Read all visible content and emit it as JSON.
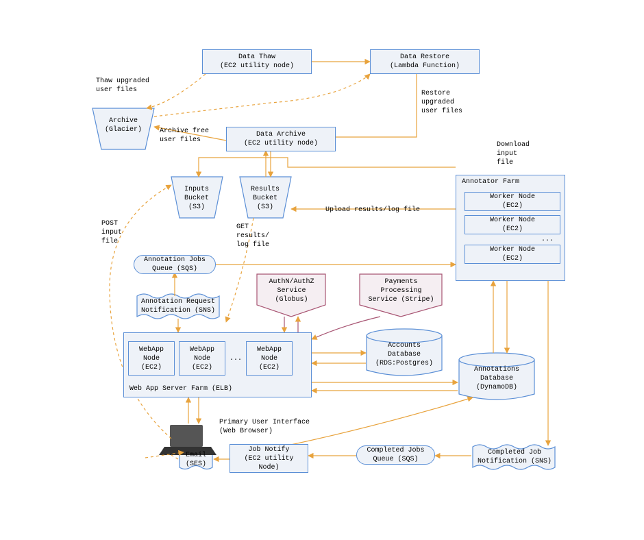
{
  "boxes": {
    "data_thaw": "Data Thaw\n(EC2 utility node)",
    "data_restore": "Data Restore\n(Lambda Function)",
    "archive": "Archive\n(Glacier)",
    "data_archive": "Data Archive\n(EC2 utility node)",
    "inputs_bucket": "Inputs\nBucket\n(S3)",
    "results_bucket": "Results\nBucket\n(S3)",
    "annotator_farm_title": "Annotator Farm",
    "worker_node": "Worker Node\n(EC2)",
    "worker_ellipsis": "...",
    "ann_jobs_queue": "Annotation Jobs\nQueue (SQS)",
    "ann_req_notif": "Annotation Request\nNotification (SNS)",
    "authn": "AuthN/AuthZ\nService\n(Globus)",
    "payments": "Payments\nProcessing\nService (Stripe)",
    "webapp_node": "WebApp\nNode\n(EC2)",
    "webapp_ellipsis": "...",
    "webapp_farm_title": "Web App Server Farm (ELB)",
    "accounts_db": "Accounts\nDatabase\n(RDS:Postgres)",
    "annotations_db": "Annotations\nDatabase\n(DynamoDB)",
    "primary_ui": "Primary User Interface\n(Web Browser)",
    "email_ses": "Email\n(SES)",
    "job_notify": "Job Notify\n(EC2 utility\nNode)",
    "completed_queue": "Completed Jobs\nQueue (SQS)",
    "completed_notif": "Completed Job\nNotification (SNS)"
  },
  "labels": {
    "thaw_upgraded": "Thaw upgraded\nuser files",
    "archive_free": "Archive free\nuser files",
    "restore_upgraded": "Restore\nupgraded\nuser files",
    "download_input": "Download\ninput\nfile",
    "upload_results": "Upload results/log file",
    "post_input": "POST\ninput\nfile",
    "get_results": "GET\nresults/\nlog file"
  }
}
